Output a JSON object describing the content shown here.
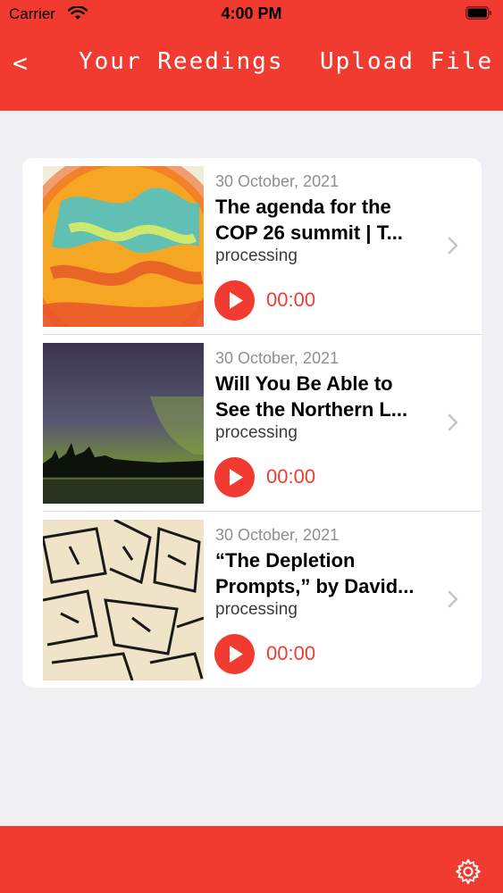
{
  "status_bar": {
    "carrier": "Carrier",
    "time": "4:00 PM"
  },
  "nav": {
    "back_label": "<",
    "title": "Your Reedings",
    "upload_label": "Upload File"
  },
  "items": [
    {
      "date": "30 October, 2021",
      "title_line1": "The agenda for the",
      "title_line2": "COP 26 summit | T...",
      "status": "processing",
      "time": "00:00"
    },
    {
      "date": "30 October, 2021",
      "title_line1": "Will You Be Able to",
      "title_line2": "See the Northern L...",
      "status": "processing",
      "time": "00:00"
    },
    {
      "date": "30 October, 2021",
      "title_line1": "“The Depletion",
      "title_line2": "Prompts,” by David...",
      "status": "processing",
      "time": "00:00"
    }
  ],
  "icons": {
    "back": "chevron-left",
    "play": "play-icon",
    "row_chevron": "chevron-right-icon",
    "settings": "gear-icon"
  },
  "colors": {
    "accent": "#f23b30",
    "background": "#efeff4"
  }
}
